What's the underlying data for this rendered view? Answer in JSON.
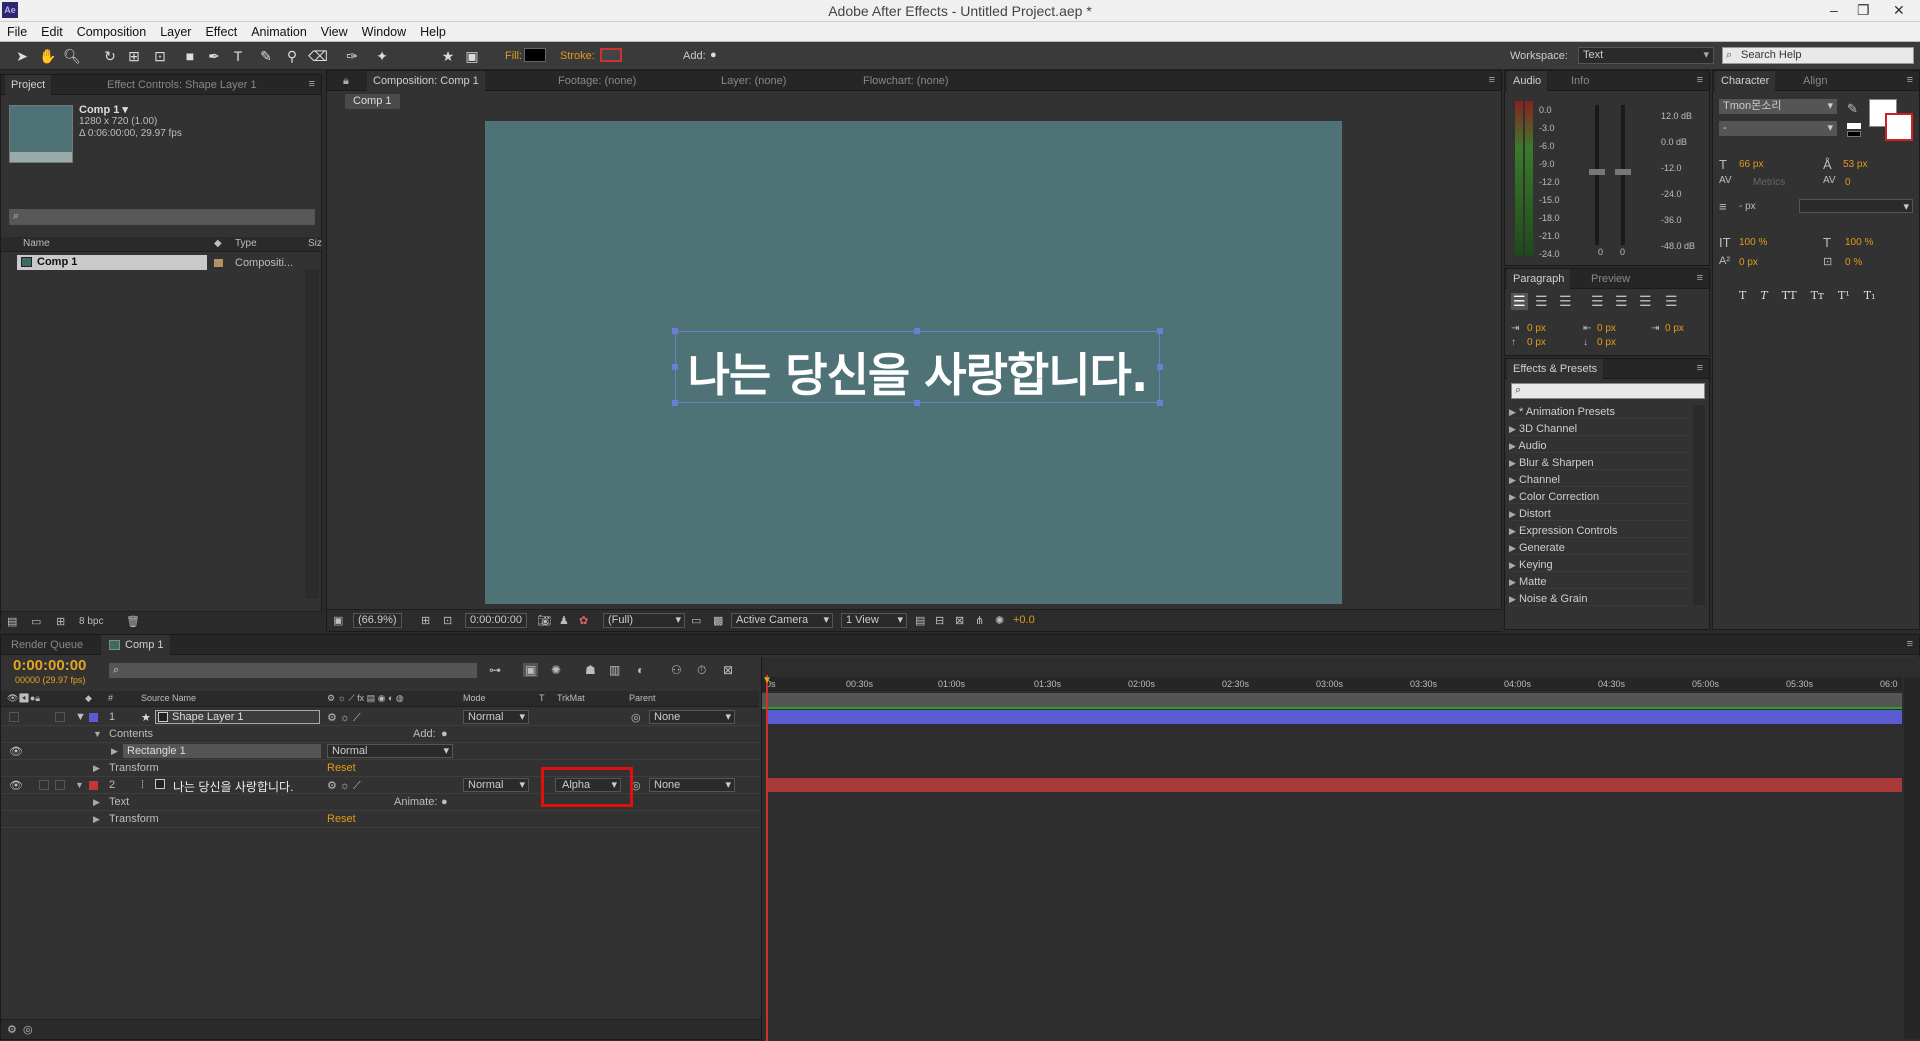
{
  "window": {
    "title": "Adobe After Effects - Untitled Project.aep *",
    "logo": "Ae",
    "controls": [
      "–",
      "❐",
      "✕"
    ]
  },
  "menu": [
    "File",
    "Edit",
    "Composition",
    "Layer",
    "Effect",
    "Animation",
    "View",
    "Window",
    "Help"
  ],
  "toolbar": {
    "fill_label": "Fill:",
    "stroke_label": "Stroke:",
    "add_label": "Add:",
    "workspace_label": "Workspace:",
    "workspace_value": "Text",
    "search_placeholder": "Search Help"
  },
  "project": {
    "tab": "Project",
    "tab2": "Effect Controls: Shape Layer 1",
    "comp_name": "Comp 1 ▾",
    "comp_info1": "1280 x 720 (1.00)",
    "comp_info2": "Δ 0:06:00:00, 29.97 fps",
    "col_name": "Name",
    "col_type": "Type",
    "col_size": "Siz",
    "item_name": "Comp 1",
    "item_type": "Compositi...",
    "bpc": "8 bpc"
  },
  "comp": {
    "tab": "Composition: Comp 1",
    "footage": "Footage: (none)",
    "layer": "Layer: (none)",
    "flowchart": "Flowchart: (none)",
    "subtab": "Comp 1",
    "text": "나는 당신을 사랑합니다.",
    "zoom": "(66.9%)",
    "timecode": "0:00:00:00",
    "resolution": "(Full)",
    "camera": "Active Camera",
    "views": "1 View",
    "exposure": "+0.0"
  },
  "audio": {
    "tab": "Audio",
    "tab2": "Info",
    "left_scale": [
      "0.0",
      "-3.0",
      "-6.0",
      "-9.0",
      "-12.0",
      "-15.0",
      "-18.0",
      "-21.0",
      "-24.0"
    ],
    "right_scale": [
      "12.0 dB",
      "0.0 dB",
      "-12.0",
      "-24.0",
      "-36.0",
      "-48.0 dB"
    ],
    "zeros": [
      "0",
      "0"
    ]
  },
  "paragraph": {
    "tab": "Paragraph",
    "tab2": "Preview",
    "vals": [
      "0 px",
      "0 px",
      "0 px",
      "0 px",
      "0 px"
    ]
  },
  "effects": {
    "tab": "Effects & Presets",
    "items": [
      "* Animation Presets",
      "3D Channel",
      "Audio",
      "Blur & Sharpen",
      "Channel",
      "Color Correction",
      "Distort",
      "Expression Controls",
      "Generate",
      "Keying",
      "Matte",
      "Noise & Grain"
    ]
  },
  "character": {
    "tab": "Character",
    "tab2": "Align",
    "font": "Tmon몬소리",
    "style": "-",
    "size": "66 px",
    "leading": "53 px",
    "kerning": "Metrics",
    "tracking": "0",
    "stroke_width": "- px",
    "vscale": "100 %",
    "hscale": "100 %",
    "baseline": "0 px",
    "tsume": "0 %",
    "styles": [
      "T",
      "T",
      "TT",
      "Tт",
      "T¹",
      "T₁"
    ]
  },
  "timeline": {
    "tab1": "Render Queue",
    "tab2": "Comp 1",
    "timecode": "0:00:00:00",
    "fps": "00000 (29.97 fps)",
    "col_hash": "#",
    "col_source": "Source Name",
    "col_mode": "Mode",
    "col_t": "T",
    "col_trkmat": "TrkMat",
    "col_parent": "Parent",
    "ruler": [
      "0s",
      "00:30s",
      "01:00s",
      "01:30s",
      "02:00s",
      "02:30s",
      "03:00s",
      "03:30s",
      "04:00s",
      "04:30s",
      "05:00s",
      "05:30s",
      "06:0"
    ],
    "layer1": {
      "num": "1",
      "name": "Shape Layer 1",
      "mode": "Normal",
      "parent": "None",
      "contents": "Contents",
      "add": "Add:",
      "rect": "Rectangle 1",
      "rect_mode": "Normal",
      "transform": "Transform",
      "reset": "Reset"
    },
    "layer2": {
      "num": "2",
      "name": "나는 당신을 사랑합니다.",
      "mode": "Normal",
      "trkmat": "Alpha",
      "parent": "None",
      "text": "Text",
      "animate": "Animate:",
      "transform": "Transform",
      "reset": "Reset"
    }
  },
  "colors": {
    "comp_bg": "#4e7276",
    "layer1_bar": "#5a5ccf",
    "layer2_bar": "#a83a3a",
    "accent": "#e39a18",
    "highlight": "#e01010"
  }
}
